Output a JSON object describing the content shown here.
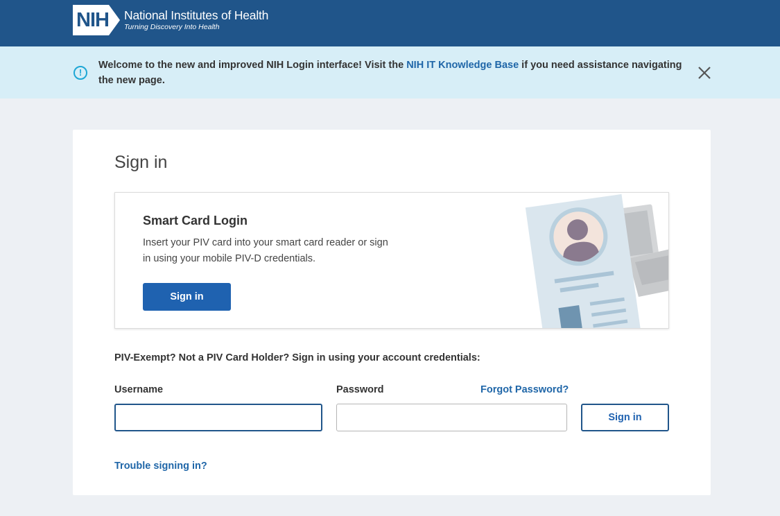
{
  "header": {
    "logo_mark": "NIH",
    "logo_title": "National Institutes of Health",
    "logo_tagline": "Turning Discovery Into Health"
  },
  "banner": {
    "icon": "info-icon",
    "message_before": "Welcome to the new and improved NIH Login interface! Visit the ",
    "link_text": "NIH IT Knowledge Base",
    "message_after": " if you need assistance navigating the new page.",
    "close_icon": "close-icon"
  },
  "page": {
    "title": "Sign in"
  },
  "smart_card": {
    "title": "Smart Card Login",
    "description": "Insert your PIV card into your smart card reader or sign in using your mobile PIV-D credentials.",
    "button_label": "Sign in"
  },
  "credentials": {
    "prompt": "PIV-Exempt? Not a PIV Card Holder? Sign in using your account credentials:",
    "username_label": "Username",
    "username_value": "",
    "password_label": "Password",
    "password_value": "",
    "forgot_password": "Forgot Password?",
    "signin_label": "Sign in",
    "trouble_link": "Trouble signing in?"
  },
  "colors": {
    "header_bg": "#20558a",
    "banner_bg": "#d7eef7",
    "page_bg": "#edf0f4",
    "primary": "#1f62b0",
    "link": "#1f66a8",
    "info": "#1ea7d5"
  }
}
